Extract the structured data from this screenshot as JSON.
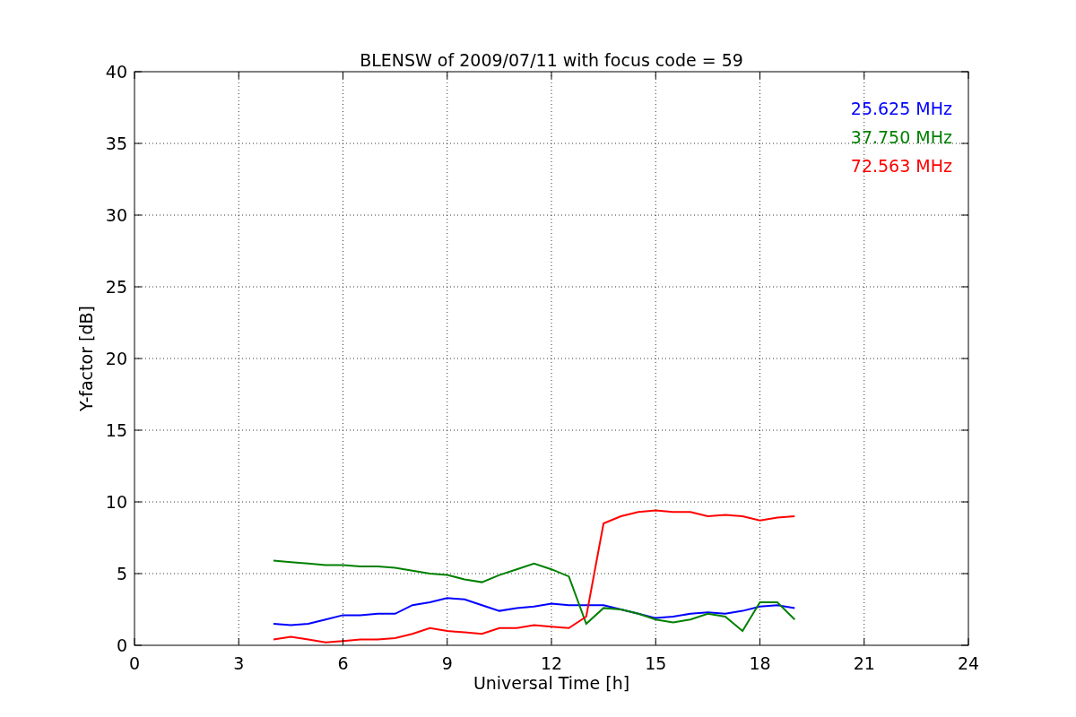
{
  "figure": {
    "chart_data": {
      "type": "line",
      "title": "BLENSW of 2009/07/11 with focus code = 59",
      "xlabel": "Universal Time [h]",
      "ylabel": "Y-factor [dB]",
      "x": [
        4,
        4.5,
        5,
        5.5,
        6,
        6.5,
        7,
        7.5,
        8,
        8.5,
        9,
        9.5,
        10,
        10.5,
        11,
        11.5,
        12,
        12.5,
        13,
        13.5,
        14,
        14.5,
        15,
        15.5,
        16,
        16.5,
        17,
        17.5,
        18,
        18.5,
        19
      ],
      "series": [
        {
          "name": "25.625 MHz",
          "color": "#0000ff",
          "values": [
            1.5,
            1.4,
            1.5,
            1.8,
            2.1,
            2.1,
            2.2,
            2.2,
            2.8,
            3.0,
            3.3,
            3.2,
            2.8,
            2.4,
            2.6,
            2.7,
            2.9,
            2.8,
            2.8,
            2.8,
            2.5,
            2.2,
            1.9,
            2.0,
            2.2,
            2.3,
            2.2,
            2.4,
            2.7,
            2.8,
            2.6
          ]
        },
        {
          "name": "37.750 MHz",
          "color": "#008000",
          "values": [
            5.9,
            5.8,
            5.7,
            5.6,
            5.6,
            5.5,
            5.5,
            5.4,
            5.2,
            5.0,
            4.9,
            4.6,
            4.4,
            4.9,
            5.3,
            5.7,
            5.3,
            4.8,
            1.5,
            2.6,
            2.5,
            2.2,
            1.8,
            1.6,
            1.8,
            2.2,
            2.0,
            1.0,
            3.0,
            3.0,
            1.8
          ]
        },
        {
          "name": "72.563 MHz",
          "color": "#ff0000",
          "values": [
            0.4,
            0.6,
            0.4,
            0.2,
            0.3,
            0.4,
            0.4,
            0.5,
            0.8,
            1.2,
            1.0,
            0.9,
            0.8,
            1.2,
            1.2,
            1.4,
            1.3,
            1.2,
            2.0,
            8.5,
            9.0,
            9.3,
            9.4,
            9.3,
            9.3,
            9.0,
            9.1,
            9.0,
            8.7,
            8.9,
            9.0
          ]
        }
      ],
      "xlim": [
        0,
        24
      ],
      "ylim": [
        0,
        40
      ],
      "xticks": [
        0,
        3,
        6,
        9,
        12,
        15,
        18,
        21,
        24
      ],
      "yticks": [
        0,
        5,
        10,
        15,
        20,
        25,
        30,
        35,
        40
      ],
      "grid": true
    }
  }
}
